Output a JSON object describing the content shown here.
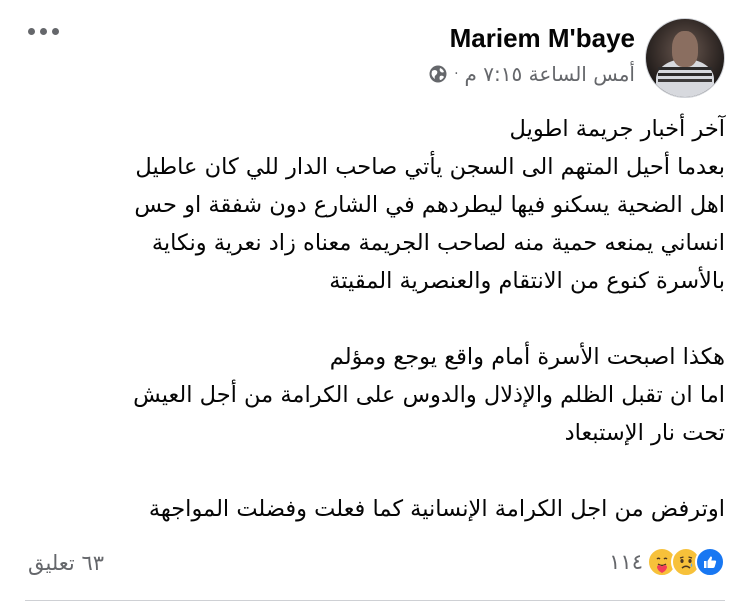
{
  "post": {
    "author": "Mariem M'baye",
    "time": "أمس الساعة ٧:١٥ م",
    "separator": "·",
    "audience_icon": "globe-icon",
    "more_icon": "more-options-icon",
    "paragraphs": [
      [
        "آخر أخبار جريمة اطويل",
        "بعدما أحيل المتهم الى السجن يأتي صاحب الدار للي كان عاطيل",
        "اهل الضحية يسكنو فيها  ليطردهم في الشارع دون شفقة او حس",
        "انساني يمنعه حمية منه لصاحب الجريمة معناه زاد نعرية ونكاية",
        "بالأسرة كنوع من الانتقام والعنصرية المقيتة"
      ],
      [
        "هكذا اصبحت الأسرة أمام واقع يوجع ومؤلم",
        "اما ان تقبل الظلم والإذلال والدوس على الكرامة من أجل العيش",
        "تحت نار الإستبعاد"
      ],
      [
        "اوترفض من اجل الكرامة الإنسانية كما فعلت وفضلت المواجهة"
      ]
    ]
  },
  "footer": {
    "reaction_count": "١١٤",
    "reaction_icons": [
      "like-icon",
      "sad-icon",
      "care-icon"
    ],
    "comments_label": "٦٣ تعليق"
  },
  "colors": {
    "text": "#050505",
    "secondary": "#65676b",
    "like_blue": "#1877f2",
    "emoji_yellow": "#f7c13a",
    "divider": "#ced0d4"
  }
}
